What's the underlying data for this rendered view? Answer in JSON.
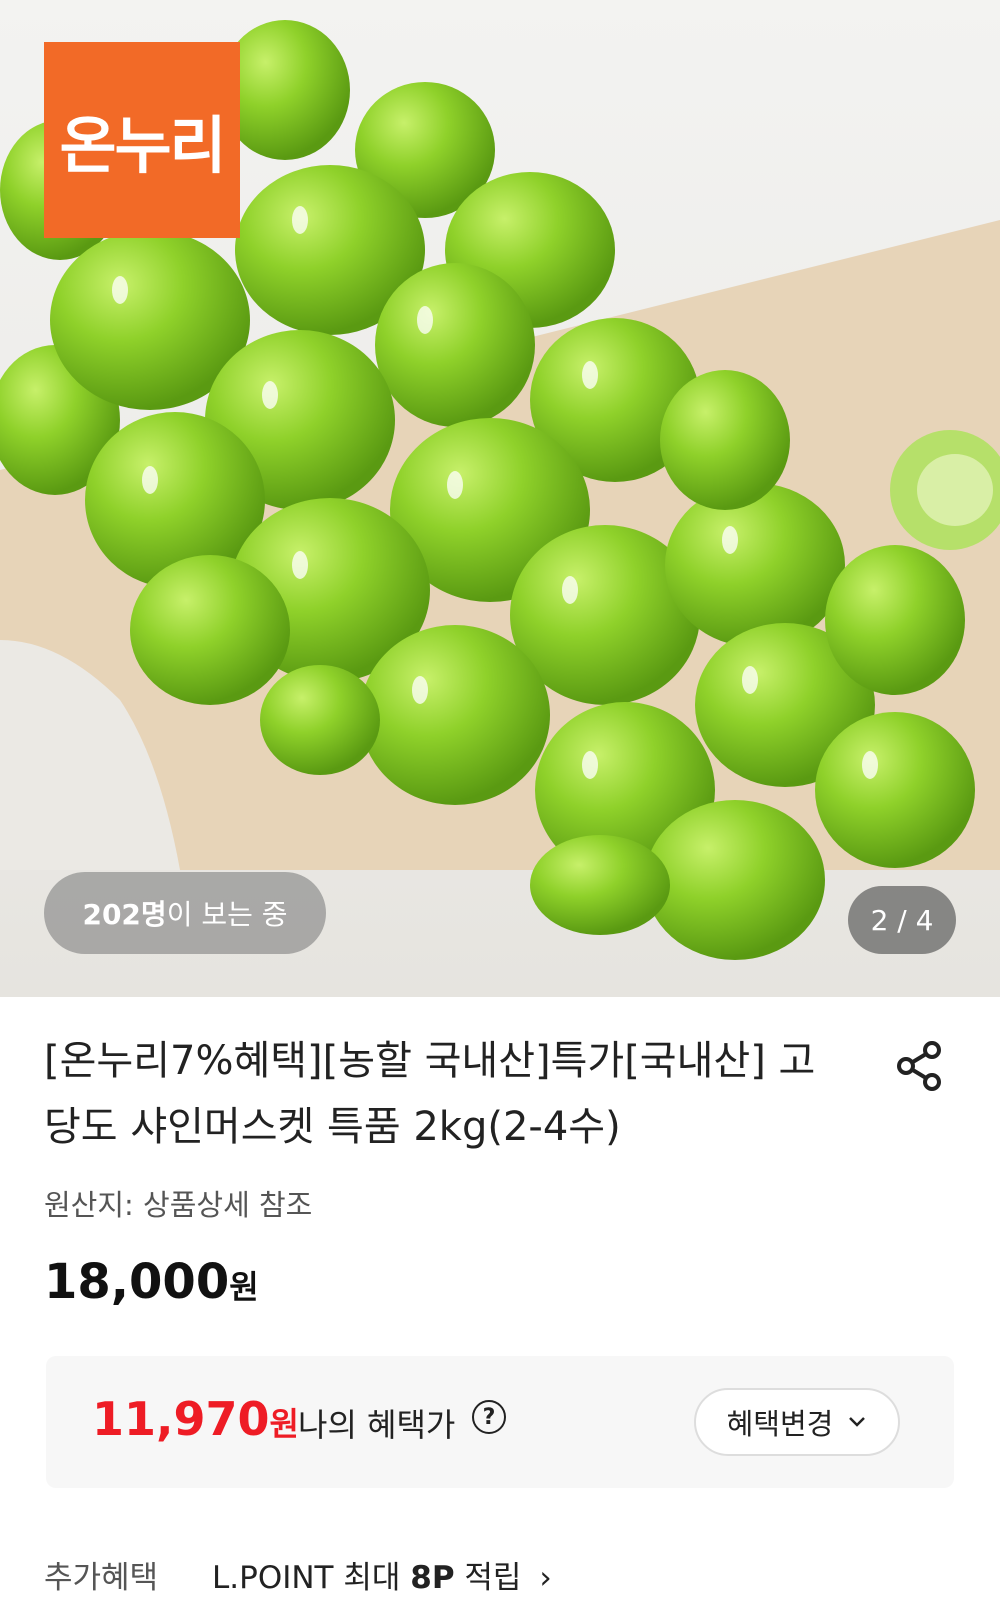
{
  "hero": {
    "logo_text": "온누리",
    "viewers_count": "202명",
    "viewers_suffix": "이 보는 중",
    "pager": "2 / 4",
    "brand_color": "#f26a27"
  },
  "product": {
    "title": "[온누리7%혜택][농할 국내산]특가[국내산] 고당도 샤인머스켓 특품 2kg(2-4수)",
    "origin": "원산지: 상품상세 참조",
    "price": "18,000",
    "price_unit": "원"
  },
  "benefit": {
    "price": "11,970",
    "price_unit": "원",
    "label": "나의 혜택가",
    "help_icon": "?",
    "change_button": "혜택변경",
    "accent_color": "#ee1c25"
  },
  "extra": {
    "label": "추가혜택",
    "detail_prefix": "L.POINT 최대 ",
    "detail_points": "8P",
    "detail_suffix": " 적립",
    "chevron": "›"
  }
}
